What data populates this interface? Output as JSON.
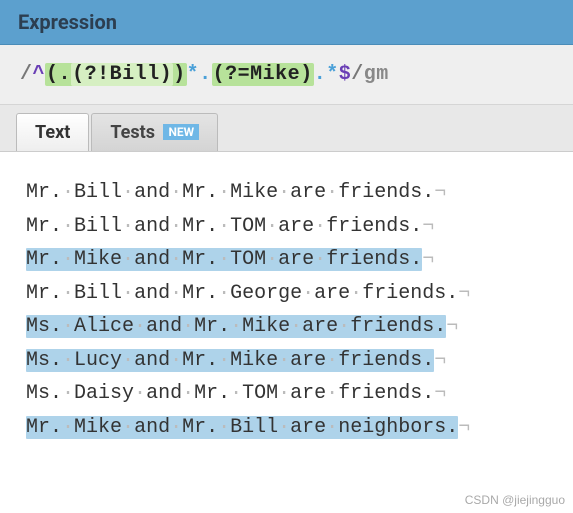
{
  "header": {
    "title": "Expression"
  },
  "expression": {
    "open_delim": "/",
    "anchor_start": "^",
    "group1_open": "(",
    "group1_dot": ".",
    "group1_inner_open": "(?!",
    "group1_inner_text": "Bill",
    "group1_inner_close": ")",
    "group1_close": ")",
    "star1": "*",
    "mid_dot": ".",
    "group2_open": "(?=",
    "group2_text": "Mike",
    "group2_close": ")",
    "tail_dot": ".",
    "star2": "*",
    "anchor_end": "$",
    "close_delim": "/",
    "flags": "gm"
  },
  "tabs": {
    "text": "Text",
    "tests": "Tests",
    "badge": "NEW"
  },
  "lines": [
    {
      "words": [
        "Mr.",
        "Bill",
        "and",
        "Mr.",
        "Mike",
        "are",
        "friends."
      ],
      "match_from": null,
      "match_to": null
    },
    {
      "words": [
        "Mr.",
        "Bill",
        "and",
        "Mr.",
        "TOM",
        "are",
        "friends."
      ],
      "match_from": null,
      "match_to": null
    },
    {
      "words": [
        "Mr.",
        "Mike",
        "and",
        "Mr.",
        "TOM",
        "are",
        "friends."
      ],
      "match_from": 0,
      "match_to": 7
    },
    {
      "words": [
        "Mr.",
        "Bill",
        "and",
        "Mr.",
        "George",
        "are",
        "friends."
      ],
      "match_from": null,
      "match_to": null
    },
    {
      "words": [
        "Ms.",
        "Alice",
        "and",
        "Mr.",
        "Mike",
        "are",
        "friends."
      ],
      "match_from": 0,
      "match_to": 7
    },
    {
      "words": [
        "Ms.",
        "Lucy",
        "and",
        "Mr.",
        "Mike",
        "are",
        "friends."
      ],
      "match_from": 0,
      "match_to": 7
    },
    {
      "words": [
        "Ms.",
        "Daisy",
        "and",
        "Mr.",
        "TOM",
        "are",
        "friends."
      ],
      "match_from": null,
      "match_to": null
    },
    {
      "words": [
        "Mr.",
        "Mike",
        "and",
        "Mr.",
        "Bill",
        "are",
        "neighbors."
      ],
      "match_from": 0,
      "match_to": 7
    }
  ],
  "watermark": "CSDN @jiejingguo"
}
